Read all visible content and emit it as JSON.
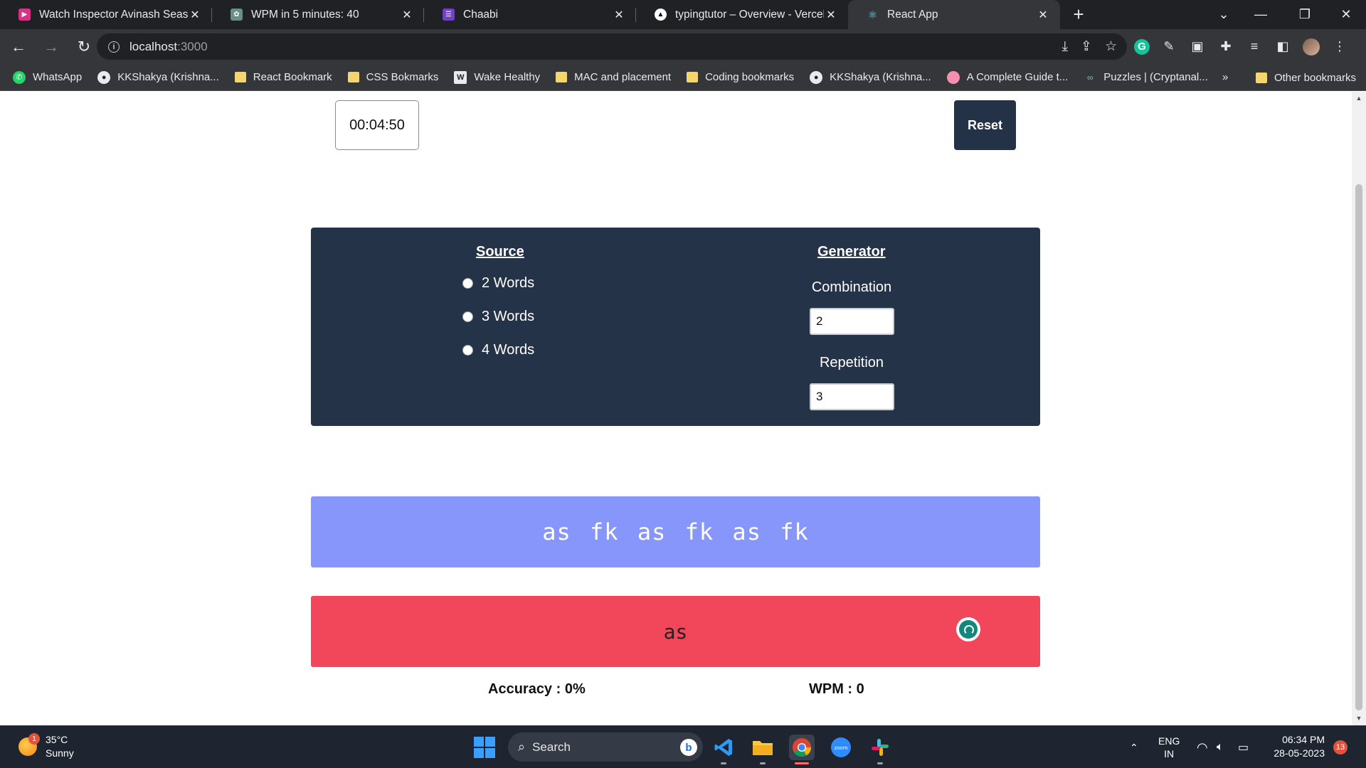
{
  "browser": {
    "tabs": [
      {
        "title": "Watch Inspector Avinash Season",
        "favicon_color": "#d63384",
        "icon": "tv-icon"
      },
      {
        "title": "WPM in 5 minutes: 40",
        "favicon_color": "#6b8f83",
        "icon": "chatgpt-icon"
      },
      {
        "title": "Chaabi",
        "favicon_color": "#6f42c1",
        "icon": "list-icon"
      },
      {
        "title": "typingtutor – Overview - Vercel",
        "favicon_color": "#ffffff",
        "icon": "vercel-icon"
      },
      {
        "title": "React App",
        "favicon_color": "#61dafb",
        "icon": "react-icon"
      }
    ],
    "active_tab": 4,
    "new_tab_label": "+",
    "url_host": "localhost",
    "url_port": ":3000",
    "bookmarks": [
      {
        "label": "WhatsApp",
        "icon": "whatsapp-icon"
      },
      {
        "label": "KKShakya (Krishna...",
        "icon": "github-icon"
      },
      {
        "label": "React Bookmark",
        "icon": "folder-icon"
      },
      {
        "label": "CSS Bokmarks",
        "icon": "folder-icon"
      },
      {
        "label": "Wake Healthy",
        "icon": "wake-healthy-icon"
      },
      {
        "label": "MAC and placement",
        "icon": "folder-icon"
      },
      {
        "label": "Coding bookmarks",
        "icon": "folder-icon"
      },
      {
        "label": "KKShakya (Krishna...",
        "icon": "github-icon"
      },
      {
        "label": "A Complete Guide t...",
        "icon": "circle-icon"
      },
      {
        "label": "Puzzles | (Cryptanal...",
        "icon": "puzzle-icon"
      }
    ],
    "bookmarks_more": "»",
    "other_bookmarks": "Other bookmarks"
  },
  "app": {
    "timer": "00:04:50",
    "reset_label": "Reset",
    "source": {
      "heading": "Source",
      "options": [
        "2 Words",
        "3 Words",
        "4 Words"
      ]
    },
    "generator": {
      "heading": "Generator",
      "combination_label": "Combination",
      "combination_value": "2",
      "repetition_label": "Repetition",
      "repetition_value": "3"
    },
    "target_text": "as fk as fk as fk",
    "typed_text": "as",
    "accuracy": "Accuracy : 0%",
    "wpm": "WPM : 0"
  },
  "colors": {
    "panel": "#253348",
    "target_bg": "#8796fb",
    "typed_bg": "#f2475a",
    "reset_bg": "#243247"
  },
  "taskbar": {
    "weather_temp": "35°C",
    "weather_desc": "Sunny",
    "weather_badge": "1",
    "search_label": "Search",
    "lang_top": "ENG",
    "lang_bottom": "IN",
    "time": "06:34 PM",
    "date": "28-05-2023",
    "notifications": "13"
  }
}
